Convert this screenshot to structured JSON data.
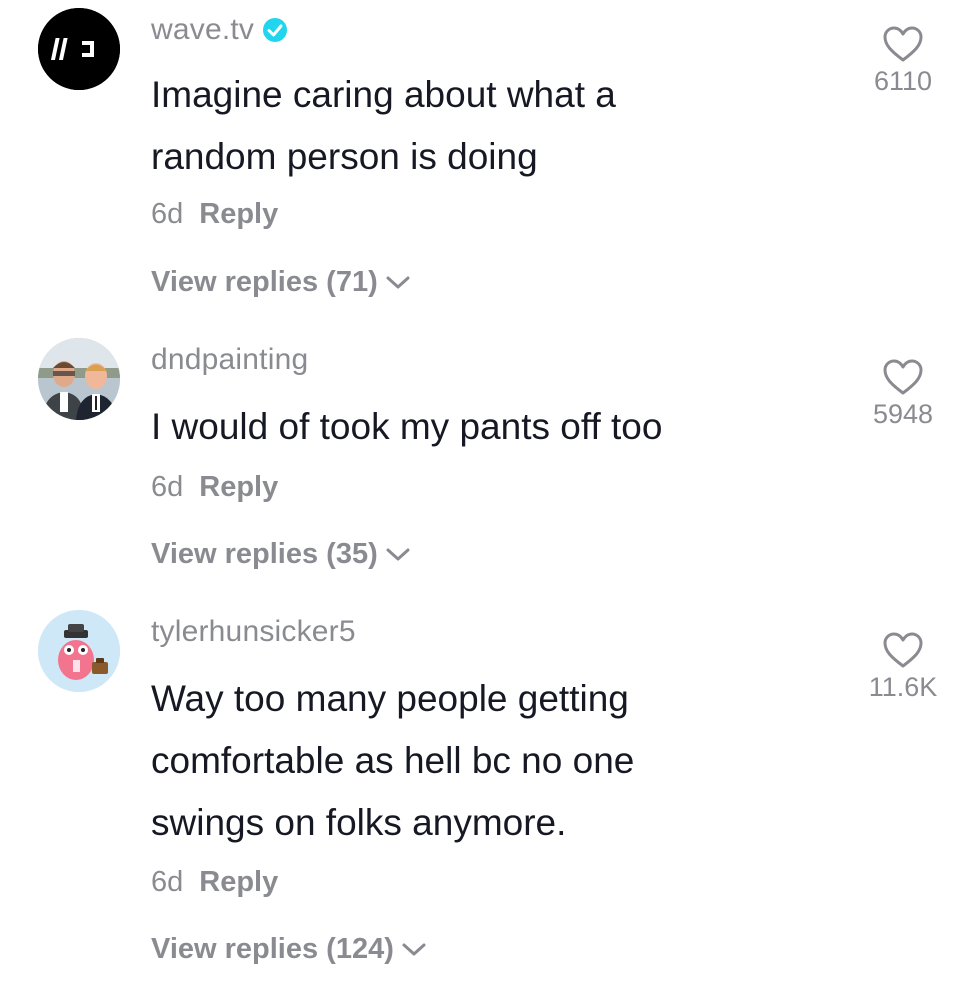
{
  "colors": {
    "primary_text": "#161823",
    "secondary_text": "#8a8b91",
    "verified_badge": "#20d5ec"
  },
  "comments": [
    {
      "username": "wave.tv",
      "verified": true,
      "avatar": "wave-logo-icon",
      "text_lines": [
        "Imagine caring about what a",
        "random person is doing"
      ],
      "time": "6d",
      "reply_label": "Reply",
      "view_replies_label": "View replies (71)",
      "like_count": "6110"
    },
    {
      "username": "dndpainting",
      "verified": false,
      "avatar": "two-men-photo",
      "text_lines": [
        "I would of took my pants off too"
      ],
      "time": "6d",
      "reply_label": "Reply",
      "view_replies_label": "View replies (35)",
      "like_count": "5948"
    },
    {
      "username": "tylerhunsicker5",
      "verified": false,
      "avatar": "cartoon-character-icon",
      "text_lines": [
        "Way too many people getting",
        "comfortable as hell bc no one",
        "swings on folks anymore."
      ],
      "time": "6d",
      "reply_label": "Reply",
      "view_replies_label": "View replies (124)",
      "like_count": "11.6K"
    }
  ]
}
